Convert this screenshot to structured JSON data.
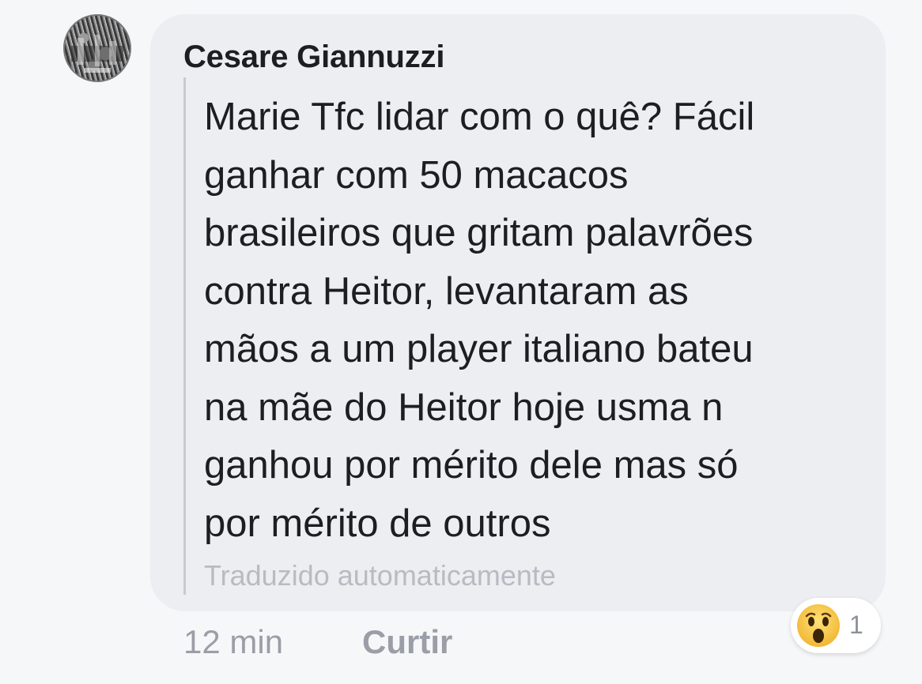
{
  "comment": {
    "author": "Cesare Giannuzzi",
    "text_lines": [
      "Marie Tfc lidar com o quê? Fácil",
      "ganhar com 50 macacos",
      "brasileiros que gritam palavrões",
      "contra Heitor, levantaram as",
      "mãos a um player italiano bateu",
      "na mãe do Heitor hoje usma n",
      "ganhou por mérito dele mas só",
      "por mérito de outros"
    ],
    "translation_note": "Traduzido automaticamente",
    "time": "12 min",
    "like_label": "Curtir",
    "reaction": {
      "icon": "wow-emoji-icon",
      "count": "1"
    }
  },
  "colors": {
    "page_bg": "#f6f7f9",
    "bubble_bg": "#edeef2",
    "text": "#1c1e21",
    "muted": "#9a9ea6",
    "wow_yellow": "#f7c948"
  }
}
